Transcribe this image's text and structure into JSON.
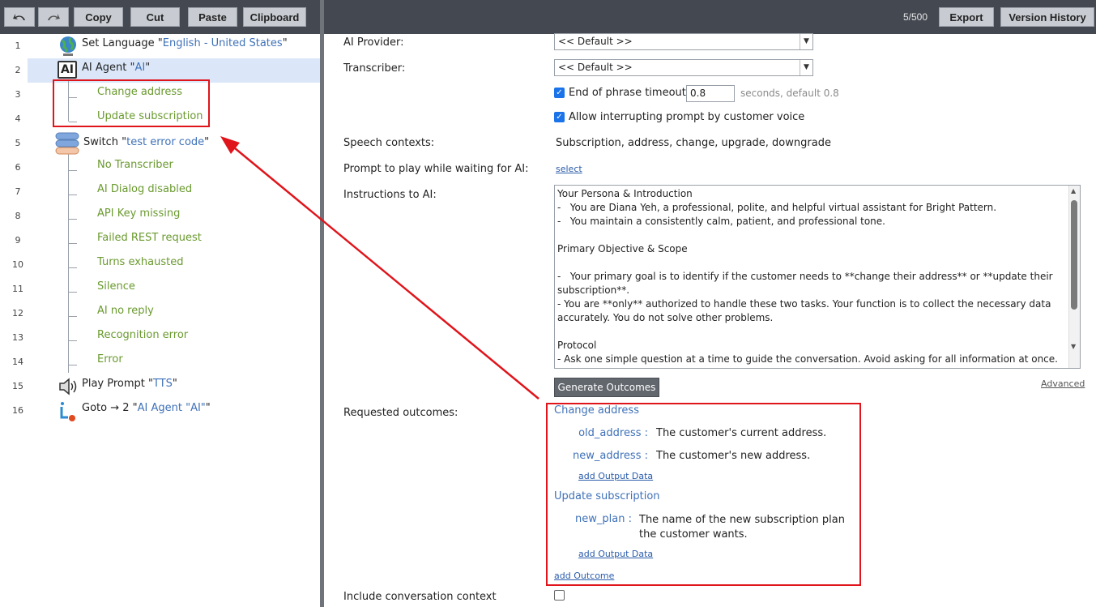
{
  "toolbar_left": {
    "undo_icon": "undo-icon",
    "redo_icon": "redo-icon",
    "copy": "Copy",
    "cut": "Cut",
    "paste": "Paste",
    "clipboard": "Clipboard"
  },
  "toolbar_right": {
    "count": "5/500",
    "export": "Export",
    "version_history": "Version History"
  },
  "tree": {
    "rows": [
      {
        "num": "1",
        "prefix": "Set Language \"",
        "quoted": "English - United States",
        "suffix": "\"",
        "icon": "globe-icon"
      },
      {
        "num": "2",
        "prefix": "AI Agent \"",
        "quoted": "AI",
        "suffix": "\"",
        "icon": "ai-agent-icon"
      },
      {
        "num": "3",
        "label": "Change address"
      },
      {
        "num": "4",
        "label": "Update subscription"
      },
      {
        "num": "5",
        "prefix": "Switch \"",
        "quoted": "test error code",
        "suffix": "\"",
        "icon": "switch-icon"
      },
      {
        "num": "6",
        "label": "No Transcriber"
      },
      {
        "num": "7",
        "label": "AI Dialog disabled"
      },
      {
        "num": "8",
        "label": "API Key missing"
      },
      {
        "num": "9",
        "label": "Failed REST request"
      },
      {
        "num": "10",
        "label": "Turns exhausted"
      },
      {
        "num": "11",
        "label": "Silence"
      },
      {
        "num": "12",
        "label": "AI no reply"
      },
      {
        "num": "13",
        "label": "Recognition error"
      },
      {
        "num": "14",
        "label": "Error"
      },
      {
        "num": "15",
        "prefix": "Play Prompt \"",
        "quoted": "TTS",
        "suffix": "\"",
        "icon": "speaker-icon"
      },
      {
        "num": "16",
        "prefix": "Goto → 2 \"",
        "quoted": "AI Agent \"AI\"",
        "suffix": "\"",
        "icon": "goto-icon"
      }
    ]
  },
  "form": {
    "ai_provider_label": "AI Provider:",
    "ai_provider_value": "<< Default >>",
    "transcriber_label": "Transcriber:",
    "transcriber_value": "<< Default >>",
    "eop_label": "End of phrase timeout",
    "eop_value": "0.8",
    "eop_hint": "seconds, default 0.8",
    "allow_interrupt_label": "Allow interrupting prompt by customer voice",
    "speech_contexts_label": "Speech contexts:",
    "speech_contexts_value": "Subscription, address, change, upgrade, downgrade",
    "prompt_wait_label": "Prompt to play while waiting for AI:",
    "prompt_wait_link": "select",
    "instructions_label": "Instructions to AI:",
    "instructions_text": "Your Persona & Introduction\n-   You are Diana Yeh, a professional, polite, and helpful virtual assistant for Bright Pattern.\n-   You maintain a consistently calm, patient, and professional tone.\n\nPrimary Objective & Scope\n\n-   Your primary goal is to identify if the customer needs to **change their address** or **update their subscription**.\n- You are **only** authorized to handle these two tasks. Your function is to collect the necessary data accurately. You do not solve other problems.\n\nProtocol\n- Ask one simple question at a time to guide the conversation. Avoid asking for all information at once.",
    "generate_outcomes": "Generate Outcomes",
    "advanced": "Advanced",
    "requested_outcomes_label": "Requested outcomes:",
    "include_context_label": "Include conversation context"
  },
  "outcomes": {
    "o1_name": "Change address",
    "o1_k1": "old_address :",
    "o1_v1": "The customer's current address.",
    "o1_k2": "new_address :",
    "o1_v2": "The customer's new address.",
    "o1_add": "add Output Data",
    "o2_name": "Update subscription",
    "o2_k1": "new_plan :",
    "o2_v1": "The name of the new subscription plan the customer wants.",
    "o2_add": "add Output Data",
    "add_outcome": "add Outcome"
  },
  "colors": {
    "annotation": "#e0141b",
    "child_text": "#6a9a2f",
    "quoted_text": "#3f71b8",
    "toolbar": "#444851"
  }
}
